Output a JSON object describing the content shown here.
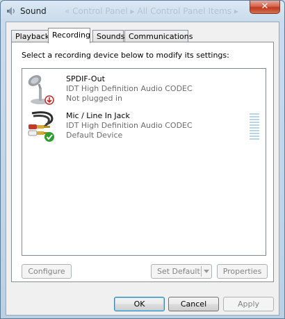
{
  "window": {
    "title": "Sound",
    "background_breadcrumb": "« Control Panel ▸ All Control Panel Items ▸",
    "close_glyph": "✕"
  },
  "tabs": [
    {
      "label": "Playback",
      "active": false
    },
    {
      "label": "Recording",
      "active": true
    },
    {
      "label": "Sounds",
      "active": false
    },
    {
      "label": "Communications",
      "active": false
    }
  ],
  "panel": {
    "instruction": "Select a recording device below to modify its settings:",
    "devices": [
      {
        "name": "SPDIF-Out",
        "driver": "IDT High Definition Audio CODEC",
        "status": "Not plugged in",
        "icon": "microphone-icon",
        "badge": "red-down-arrow-badge"
      },
      {
        "name": "Mic / Line In Jack",
        "driver": "IDT High Definition Audio CODEC",
        "status": "Default Device",
        "icon": "rca-cable-icon",
        "badge": "green-check-badge",
        "level_meter": true
      }
    ],
    "configure_label": "Configure",
    "set_default_label": "Set Default",
    "properties_label": "Properties"
  },
  "footer": {
    "ok_label": "OK",
    "cancel_label": "Cancel",
    "apply_label": "Apply"
  },
  "colors": {
    "accent_default_button": "#3c7fb1",
    "close_button": "#c0391d",
    "badge_check": "#2f9e2f",
    "badge_arrow": "#c62828"
  }
}
